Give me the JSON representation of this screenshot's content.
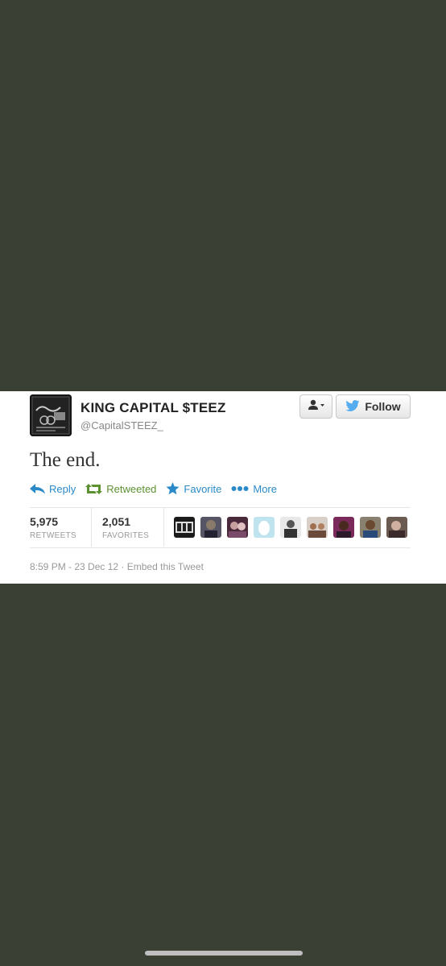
{
  "tweet": {
    "display_name": "KING CAPITAL $TEEZ",
    "handle": "@CapitalSTEEZ_",
    "text": "The end.",
    "follow_label": "Follow",
    "actions": {
      "reply": "Reply",
      "retweeted": "Retweeted",
      "favorite": "Favorite",
      "more": "More"
    },
    "stats": {
      "retweets_count": "5,975",
      "retweets_label": "RETWEETS",
      "favorites_count": "2,051",
      "favorites_label": "FAVORITES"
    },
    "timestamp": "8:59 PM - 23 Dec 12",
    "separator": "·",
    "embed_label": "Embed this Tweet",
    "favoriters": [
      "avatar-cym",
      "avatar-2",
      "avatar-3",
      "avatar-egg",
      "avatar-5",
      "avatar-6",
      "avatar-7",
      "avatar-8",
      "avatar-9"
    ]
  },
  "colors": {
    "background": "#3a4134",
    "link_blue": "#2a8ac9",
    "retweeted_green": "#5c9131",
    "twitter_bird": "#55acee"
  }
}
